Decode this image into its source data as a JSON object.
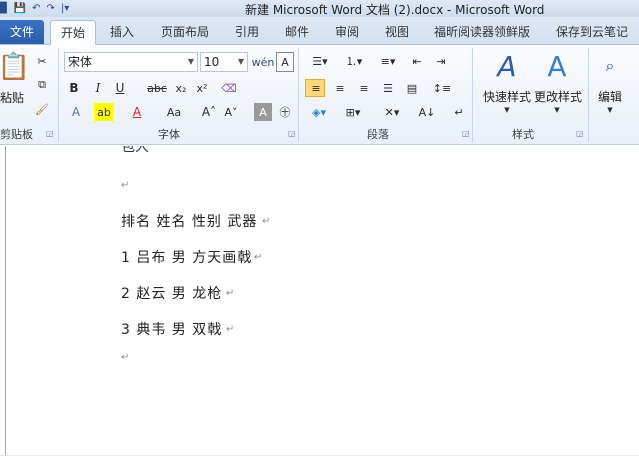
{
  "window": {
    "title": "新建 Microsoft Word 文档 (2).docx  -  Microsoft Word"
  },
  "tabs": {
    "file": "文件",
    "items": [
      "开始",
      "插入",
      "页面布局",
      "引用",
      "邮件",
      "审阅",
      "视图",
      "福昕阅读器领鲜版",
      "保存到云笔记"
    ]
  },
  "ribbon": {
    "clipboard": {
      "paste": "粘贴",
      "label": "剪贴板"
    },
    "font": {
      "name": "宋体",
      "size": "10",
      "label": "字体"
    },
    "paragraph": {
      "label": "段落"
    },
    "styles": {
      "quick": "快速样式",
      "change": "更改样式",
      "label": "样式"
    },
    "editing": {
      "label": "编辑"
    }
  },
  "document": {
    "partial_top": "包大",
    "lines": [
      "排名  姓名  性别  武器",
      "1  吕布  男  方天画戟",
      "2  赵云  男  龙枪",
      "3  典韦  男  双戟"
    ]
  },
  "colors": {
    "file_tab": "#2a5caa",
    "ribbon_bg": "#f2f6fb",
    "active_paragraph_button": "#fbd97a"
  }
}
